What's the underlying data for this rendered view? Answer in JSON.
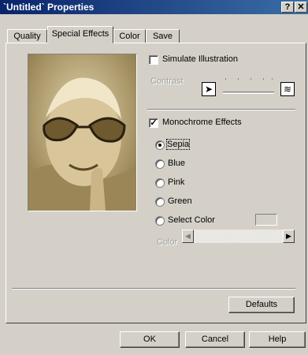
{
  "window": {
    "title": "`Untitled` Properties",
    "help_glyph": "?",
    "close_glyph": "✕"
  },
  "tabs": [
    {
      "label": "Quality"
    },
    {
      "label": "Special Effects",
      "active": true
    },
    {
      "label": "Color"
    },
    {
      "label": "Save"
    }
  ],
  "effects": {
    "simulate_illustration": {
      "label": "Simulate Illustration",
      "checked": false
    },
    "contrast": {
      "label": "Contrast",
      "enabled": false
    },
    "monochrome": {
      "label": "Monochrome Effects",
      "checked": true,
      "check_glyph": "✓"
    },
    "tones": [
      {
        "label": "Sepia",
        "selected": true
      },
      {
        "label": "Blue",
        "selected": false
      },
      {
        "label": "Pink",
        "selected": false
      },
      {
        "label": "Green",
        "selected": false
      },
      {
        "label": "Select Color",
        "selected": false
      }
    ],
    "color_slider": {
      "label": "Color",
      "left_arrow": "◀",
      "right_arrow": "▶"
    }
  },
  "buttons": {
    "defaults": "Defaults",
    "ok": "OK",
    "cancel": "Cancel",
    "help": "Help"
  },
  "colors": {
    "title_start": "#0a246a",
    "title_end": "#3a6ea5",
    "face": "#d4d0c8",
    "sepia": "#c7b485"
  },
  "icons": {
    "photo": "sepia-photo-icon",
    "contrast_low": "contrast-low-icon",
    "contrast_high": "contrast-high-icon"
  }
}
